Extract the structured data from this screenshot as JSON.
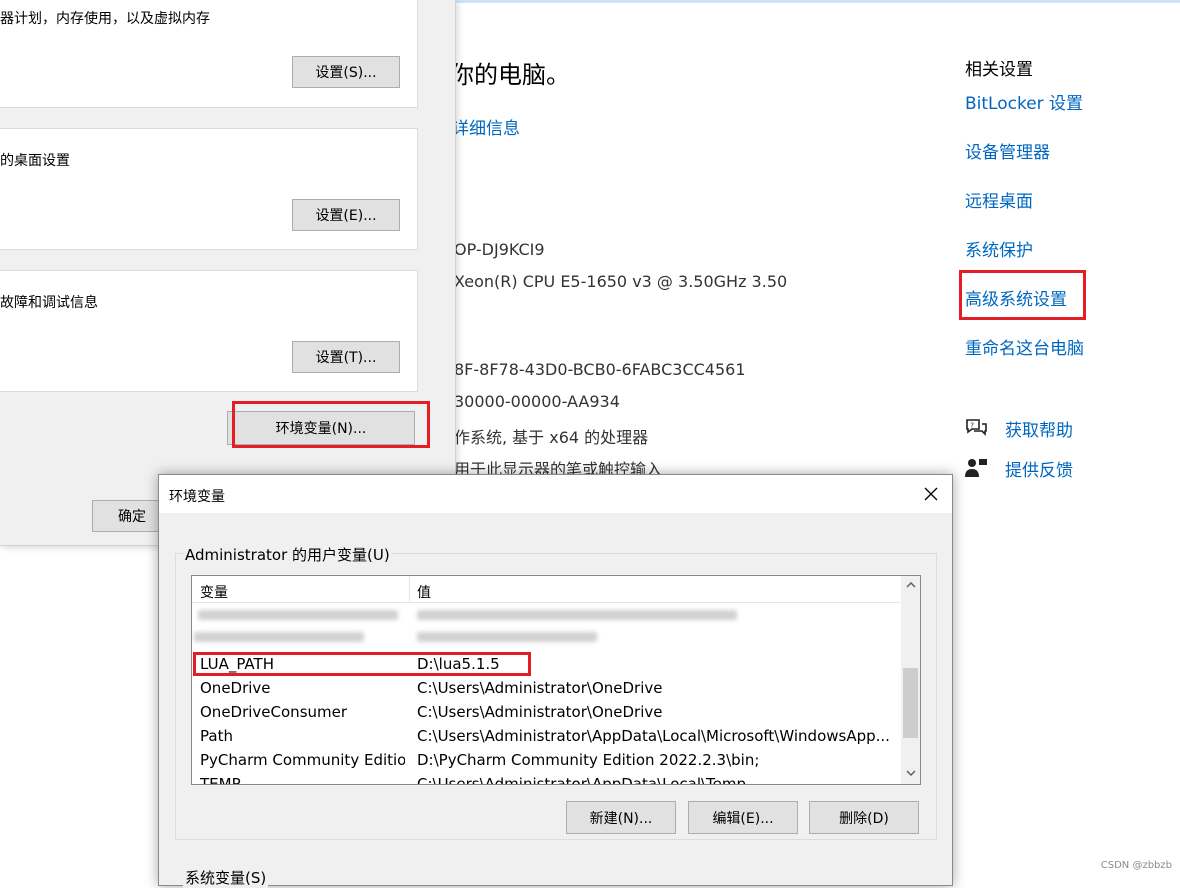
{
  "settings_page": {
    "heading": "你的电脑。",
    "details_link": "详细信息",
    "specs": [
      "OP-DJ9KCI9",
      "Xeon(R) CPU E5-1650 v3 @ 3.50GHz   3.50",
      "8F-8F78-43D0-BCB0-6FABC3CC4561",
      "30000-00000-AA934",
      "作系统, 基于 x64 的处理器",
      "用于此显示器的笔或触控输入"
    ],
    "related": {
      "title": "相关设置",
      "links": [
        "BitLocker 设置",
        "设备管理器",
        "远程桌面",
        "系统保护",
        "高级系统设置",
        "重命名这台电脑"
      ]
    },
    "help": {
      "get_help": "获取帮助",
      "feedback": "提供反馈"
    }
  },
  "system_properties": {
    "groups": [
      {
        "text": "器计划，内存使用，以及虚拟内存",
        "button": "设置(S)..."
      },
      {
        "text": "的桌面设置",
        "button": "设置(E)..."
      },
      {
        "text": "故障和调试信息",
        "button": "设置(T)..."
      }
    ],
    "env_button": "环境变量(N)...",
    "ok_button": "确定"
  },
  "env_dialog": {
    "title": "环境变量",
    "user_group_label": "Administrator 的用户变量(U)",
    "columns": {
      "variable": "变量",
      "value": "值"
    },
    "rows": [
      {
        "name": "LUA_PATH",
        "value": "D:\\lua5.1.5"
      },
      {
        "name": "OneDrive",
        "value": "C:\\Users\\Administrator\\OneDrive"
      },
      {
        "name": "OneDriveConsumer",
        "value": "C:\\Users\\Administrator\\OneDrive"
      },
      {
        "name": "Path",
        "value": "C:\\Users\\Administrator\\AppData\\Local\\Microsoft\\WindowsApp..."
      },
      {
        "name": "PyCharm Community Edition",
        "value": "D:\\PyCharm Community Edition 2022.2.3\\bin;"
      },
      {
        "name": "TEMP",
        "value": "C:\\Users\\Administrator\\AppData\\Local\\Temp"
      }
    ],
    "buttons": {
      "new": "新建(N)...",
      "edit": "编辑(E)...",
      "delete": "删除(D)"
    },
    "system_group_label": "系统变量(S)"
  },
  "watermark": "CSDN @zbbzb",
  "colors": {
    "link": "#0067c0",
    "highlight": "#e31e24"
  }
}
